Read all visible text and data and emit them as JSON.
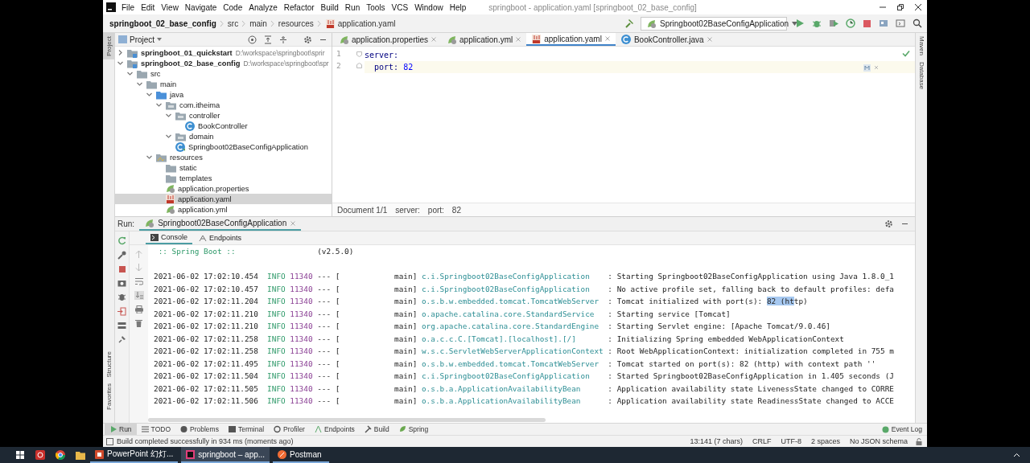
{
  "title_bar": {
    "menu": [
      "File",
      "Edit",
      "View",
      "Navigate",
      "Code",
      "Analyze",
      "Refactor",
      "Build",
      "Run",
      "Tools",
      "VCS",
      "Window",
      "Help"
    ],
    "title": "springboot - application.yaml [springboot_02_base_config]"
  },
  "nav_bar": {
    "breadcrumbs": [
      {
        "label": "springboot_02_base_config",
        "kind": "module"
      },
      {
        "label": "src",
        "kind": "folder"
      },
      {
        "label": "main",
        "kind": "folder"
      },
      {
        "label": "resources",
        "kind": "folder"
      },
      {
        "label": "application.yaml",
        "kind": "yaml"
      }
    ],
    "run_config": "Springboot02BaseConfigApplication"
  },
  "left_strip": [
    {
      "label": "Project",
      "selected": true
    },
    {
      "label": "Structure",
      "selected": false
    },
    {
      "label": "Favorites",
      "selected": false
    }
  ],
  "right_strip": [
    {
      "label": "Maven"
    },
    {
      "label": "Database"
    }
  ],
  "project": {
    "title": "Project",
    "tree": [
      {
        "label": "springboot_01_quickstart",
        "kind": "module",
        "path": "D:\\workspace\\springboot\\sprir",
        "expanded": false,
        "selected": false
      },
      {
        "label": "springboot_02_base_config",
        "kind": "module",
        "path": "D:\\workspace\\springboot\\spr",
        "expanded": true,
        "selected": false,
        "children": [
          {
            "label": "src",
            "kind": "folder",
            "expanded": true,
            "selected": false,
            "children": [
              {
                "label": "main",
                "kind": "folder",
                "expanded": true,
                "selected": false,
                "children": [
                  {
                    "label": "java",
                    "kind": "source",
                    "expanded": true,
                    "selected": false,
                    "children": [
                      {
                        "label": "com.itheima",
                        "kind": "package",
                        "expanded": true,
                        "selected": false,
                        "children": [
                          {
                            "label": "controller",
                            "kind": "package",
                            "expanded": true,
                            "selected": false,
                            "children": [
                              {
                                "label": "BookController",
                                "kind": "class",
                                "selected": false
                              }
                            ]
                          },
                          {
                            "label": "domain",
                            "kind": "package",
                            "expanded": true,
                            "selected": false
                          },
                          {
                            "label": "Springboot02BaseConfigApplication",
                            "kind": "app-class",
                            "selected": false
                          }
                        ]
                      }
                    ]
                  },
                  {
                    "label": "resources",
                    "kind": "resources",
                    "expanded": true,
                    "selected": false,
                    "children": [
                      {
                        "label": "static",
                        "kind": "folder",
                        "selected": false
                      },
                      {
                        "label": "templates",
                        "kind": "folder",
                        "selected": false
                      },
                      {
                        "label": "application.properties",
                        "kind": "properties",
                        "selected": false
                      },
                      {
                        "label": "application.yaml",
                        "kind": "yaml",
                        "selected": true
                      },
                      {
                        "label": "application.yml",
                        "kind": "properties",
                        "selected": false
                      }
                    ]
                  }
                ]
              }
            ]
          }
        ]
      }
    ]
  },
  "editor": {
    "tabs": [
      {
        "label": "application.properties",
        "kind": "properties",
        "selected": false
      },
      {
        "label": "application.yml",
        "kind": "properties",
        "selected": false
      },
      {
        "label": "application.yaml",
        "kind": "yaml",
        "selected": true
      },
      {
        "label": "BookController.java",
        "kind": "class",
        "selected": false
      }
    ],
    "line_numbers": [
      "1",
      "2"
    ],
    "yaml": [
      {
        "key": "server:",
        "current": false,
        "children": [
          {
            "key": "port:",
            "value": "82",
            "current": true
          }
        ]
      }
    ],
    "breadcrumbs": [
      "Document 1/1",
      "server:",
      "port:",
      "82"
    ]
  },
  "run": {
    "label": "Run:",
    "tab": "Springboot02BaseConfigApplication",
    "subtabs": [
      {
        "label": "Console",
        "selected": true
      },
      {
        "label": "Endpoints",
        "selected": false
      }
    ],
    "banner": {
      "name": ":: Spring Boot ::",
      "version": "(v2.5.0)"
    },
    "log": [
      {
        "time": "2021-06-02 17:02:10.454",
        "level": "INFO",
        "pid": "11340",
        "sep": "---",
        "open": "[",
        "thread": "main]",
        "logger": "c.i.Springboot02BaseConfigApplication",
        "message": ": Starting Springboot02BaseConfigApplication using Java 1.8.0_1"
      },
      {
        "time": "2021-06-02 17:02:10.457",
        "level": "INFO",
        "pid": "11340",
        "sep": "---",
        "open": "[",
        "thread": "main]",
        "logger": "c.i.Springboot02BaseConfigApplication",
        "message": ": No active profile set, falling back to default profiles: defa"
      },
      {
        "time": "2021-06-02 17:02:11.204",
        "level": "INFO",
        "pid": "11340",
        "sep": "---",
        "open": "[",
        "thread": "main]",
        "logger": "o.s.b.w.embedded.tomcat.TomcatWebServer",
        "message": [
          {
            "text": ": Tomcat initialized with port(s): ",
            "selected": false
          },
          {
            "text": "82 (ht",
            "selected": true
          },
          {
            "text": "tp)",
            "selected": false
          }
        ]
      },
      {
        "time": "2021-06-02 17:02:11.210",
        "level": "INFO",
        "pid": "11340",
        "sep": "---",
        "open": "[",
        "thread": "main]",
        "logger": "o.apache.catalina.core.StandardService",
        "message": ": Starting service [Tomcat]"
      },
      {
        "time": "2021-06-02 17:02:11.210",
        "level": "INFO",
        "pid": "11340",
        "sep": "---",
        "open": "[",
        "thread": "main]",
        "logger": "org.apache.catalina.core.StandardEngine",
        "message": ": Starting Servlet engine: [Apache Tomcat/9.0.46]"
      },
      {
        "time": "2021-06-02 17:02:11.258",
        "level": "INFO",
        "pid": "11340",
        "sep": "---",
        "open": "[",
        "thread": "main]",
        "logger": "o.a.c.c.C.[Tomcat].[localhost].[/]",
        "message": ": Initializing Spring embedded WebApplicationContext"
      },
      {
        "time": "2021-06-02 17:02:11.258",
        "level": "INFO",
        "pid": "11340",
        "sep": "---",
        "open": "[",
        "thread": "main]",
        "logger": "w.s.c.ServletWebServerApplicationContext",
        "message": ": Root WebApplicationContext: initialization completed in 755 m"
      },
      {
        "time": "2021-06-02 17:02:11.495",
        "level": "INFO",
        "pid": "11340",
        "sep": "---",
        "open": "[",
        "thread": "main]",
        "logger": "o.s.b.w.embedded.tomcat.TomcatWebServer",
        "message": ": Tomcat started on port(s): 82 (http) with context path ''"
      },
      {
        "time": "2021-06-02 17:02:11.504",
        "level": "INFO",
        "pid": "11340",
        "sep": "---",
        "open": "[",
        "thread": "main]",
        "logger": "c.i.Springboot02BaseConfigApplication",
        "message": ": Started Springboot02BaseConfigApplication in 1.405 seconds (J"
      },
      {
        "time": "2021-06-02 17:02:11.505",
        "level": "INFO",
        "pid": "11340",
        "sep": "---",
        "open": "[",
        "thread": "main]",
        "logger": "o.s.b.a.ApplicationAvailabilityBean",
        "message": ": Application availability state LivenessState changed to CORRE"
      },
      {
        "time": "2021-06-02 17:02:11.506",
        "level": "INFO",
        "pid": "11340",
        "sep": "---",
        "open": "[",
        "thread": "main]",
        "logger": "o.s.b.a.ApplicationAvailabilityBean",
        "message": ": Application availability state ReadinessState changed to ACCE"
      }
    ]
  },
  "tool_windows": [
    {
      "label": "Run",
      "kind": "run",
      "selected": true
    },
    {
      "label": "TODO",
      "kind": "todo",
      "selected": false
    },
    {
      "label": "Problems",
      "kind": "problems",
      "selected": false
    },
    {
      "label": "Terminal",
      "kind": "terminal",
      "selected": false
    },
    {
      "label": "Profiler",
      "kind": "profiler",
      "selected": false
    },
    {
      "label": "Endpoints",
      "kind": "endpoints",
      "selected": false
    },
    {
      "label": "Build",
      "kind": "build",
      "selected": false
    },
    {
      "label": "Spring",
      "kind": "spring",
      "selected": false
    }
  ],
  "event_log": "Event Log",
  "status_bar": {
    "message": "Build completed successfully in 934 ms (moments ago)",
    "fields": [
      "13:141 (7 chars)",
      "CRLF",
      "UTF-8",
      "2 spaces",
      "No JSON schema"
    ]
  },
  "taskbar": {
    "apps": [
      {
        "label": "PowerPoint 幻灯...",
        "kind": "powerpoint",
        "active": false
      },
      {
        "label": "springboot – app...",
        "kind": "idea",
        "active": true
      },
      {
        "label": "Postman",
        "kind": "postman",
        "active": false
      }
    ]
  }
}
